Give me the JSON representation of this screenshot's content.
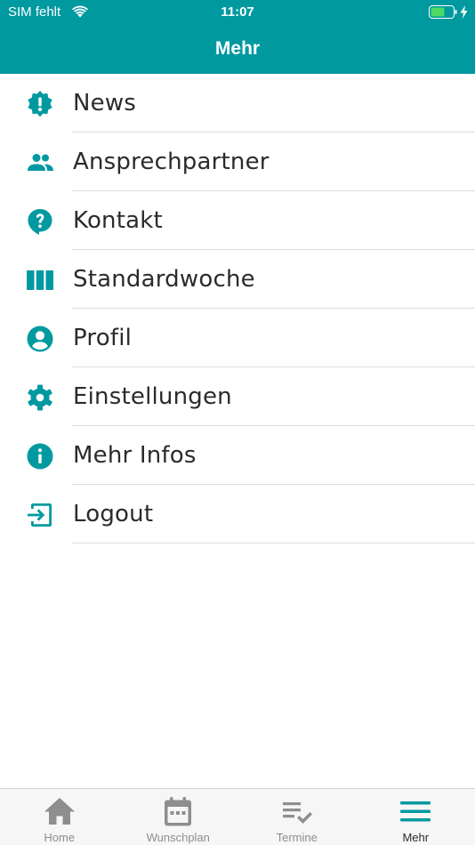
{
  "status_bar": {
    "carrier": "SIM fehlt",
    "time": "11:07"
  },
  "header": {
    "title": "Mehr"
  },
  "accent_color": "#0099a0",
  "menu": {
    "items": [
      {
        "label": "News",
        "icon": "news-badge-icon"
      },
      {
        "label": "Ansprechpartner",
        "icon": "people-icon"
      },
      {
        "label": "Kontakt",
        "icon": "help-bubble-icon"
      },
      {
        "label": "Standardwoche",
        "icon": "columns-icon"
      },
      {
        "label": "Profil",
        "icon": "account-circle-icon"
      },
      {
        "label": "Einstellungen",
        "icon": "gear-icon"
      },
      {
        "label": "Mehr Infos",
        "icon": "info-icon"
      },
      {
        "label": "Logout",
        "icon": "logout-icon"
      }
    ]
  },
  "tabbar": {
    "tabs": [
      {
        "label": "Home",
        "icon": "home-icon",
        "active": false
      },
      {
        "label": "Wunschplan",
        "icon": "calendar-icon",
        "active": false
      },
      {
        "label": "Termine",
        "icon": "checklist-icon",
        "active": false
      },
      {
        "label": "Mehr",
        "icon": "hamburger-menu-icon",
        "active": true
      }
    ]
  }
}
